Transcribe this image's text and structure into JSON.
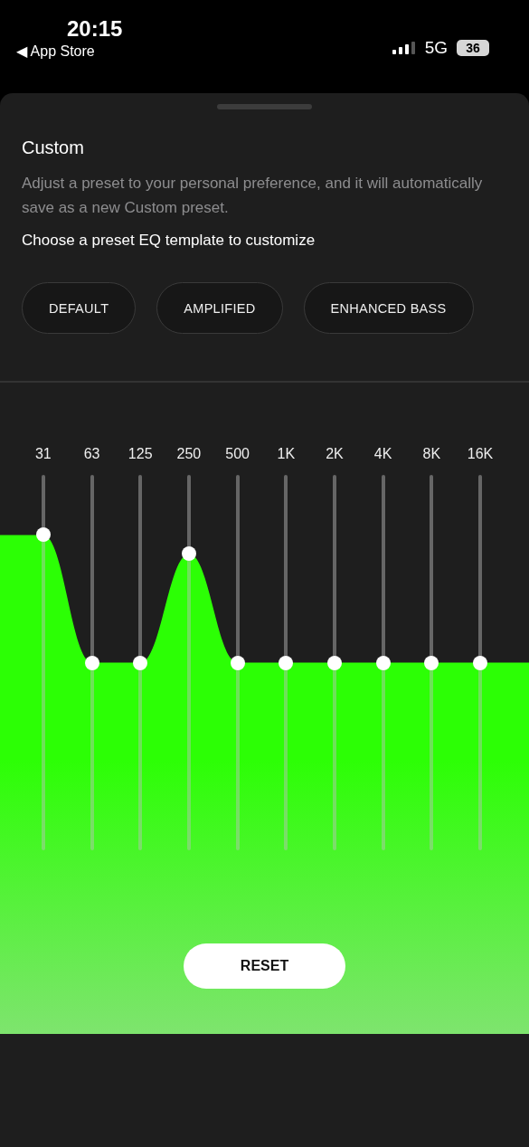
{
  "status_bar": {
    "time": "20:15",
    "back_label": "◀ App Store",
    "network": "5G",
    "battery": "36"
  },
  "sheet": {
    "title": "Custom",
    "description": "Adjust a preset to your personal preference, and it will automatically save as a new Custom preset.",
    "prompt": "Choose a preset EQ template to customize"
  },
  "presets": [
    {
      "label": "DEFAULT"
    },
    {
      "label": "AMPLIFIED"
    },
    {
      "label": "ENHANCED BASS"
    }
  ],
  "equalizer": {
    "bands": [
      {
        "label": "31",
        "level": 0.84
      },
      {
        "label": "63",
        "level": 0.5
      },
      {
        "label": "125",
        "level": 0.5
      },
      {
        "label": "250",
        "level": 0.79
      },
      {
        "label": "500",
        "level": 0.5
      },
      {
        "label": "1K",
        "level": 0.5
      },
      {
        "label": "2K",
        "level": 0.5
      },
      {
        "label": "4K",
        "level": 0.5
      },
      {
        "label": "8K",
        "level": 0.5
      },
      {
        "label": "16K",
        "level": 0.5
      }
    ]
  },
  "reset_button": "RESET"
}
